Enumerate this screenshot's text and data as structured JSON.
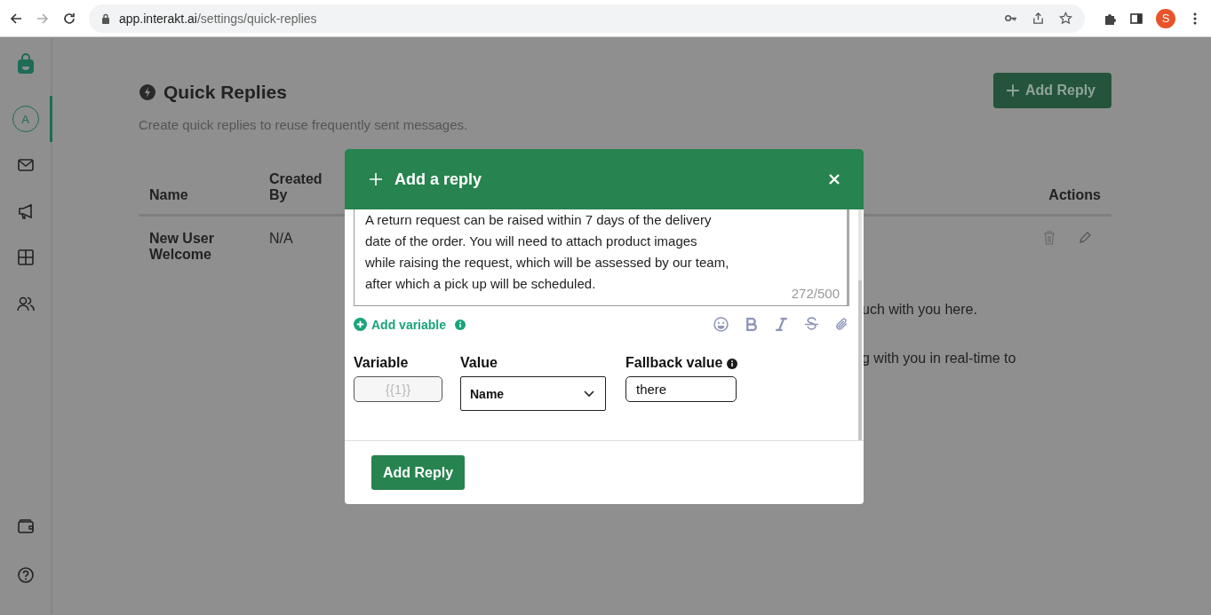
{
  "browser": {
    "url_host": "app.interakt.ai",
    "url_path": "/settings/quick-replies",
    "profile_initial": "S"
  },
  "sidebar": {
    "avatar_initial": "A",
    "items": [
      {
        "kind": "avatar",
        "selected": true
      },
      {
        "kind": "mail",
        "selected": false
      },
      {
        "kind": "megaphone",
        "selected": false
      },
      {
        "kind": "grid",
        "selected": false
      },
      {
        "kind": "users",
        "selected": false
      }
    ],
    "bottom_items": [
      {
        "kind": "wallet"
      },
      {
        "kind": "help"
      }
    ]
  },
  "page": {
    "title": "Quick Replies",
    "subtitle": "Create quick replies to reuse frequently sent messages.",
    "add_button": "Add Reply",
    "table": {
      "columns": [
        "Name",
        "Created By",
        "Actions"
      ],
      "rows": [
        {
          "name": "New User Welcome",
          "created_by": "N/A"
        }
      ]
    },
    "visible_fragments": [
      "uch with you here.",
      "g with you in real-time to"
    ]
  },
  "modal": {
    "title": "Add a reply",
    "message_lines": [
      "A return request can be raised within 7 days of the delivery",
      "date of the order. You will need to attach product images",
      "while raising the request, which will be assessed by our team,",
      "after which a pick up will be scheduled."
    ],
    "counter": "272/500",
    "add_variable": "Add variable",
    "variable_label": "Variable",
    "value_label": "Value",
    "fallback_label": "Fallback value",
    "variables": [
      {
        "variable": "{{1}}",
        "value": "Name",
        "fallback": "there"
      }
    ],
    "submit": "Add Reply"
  }
}
